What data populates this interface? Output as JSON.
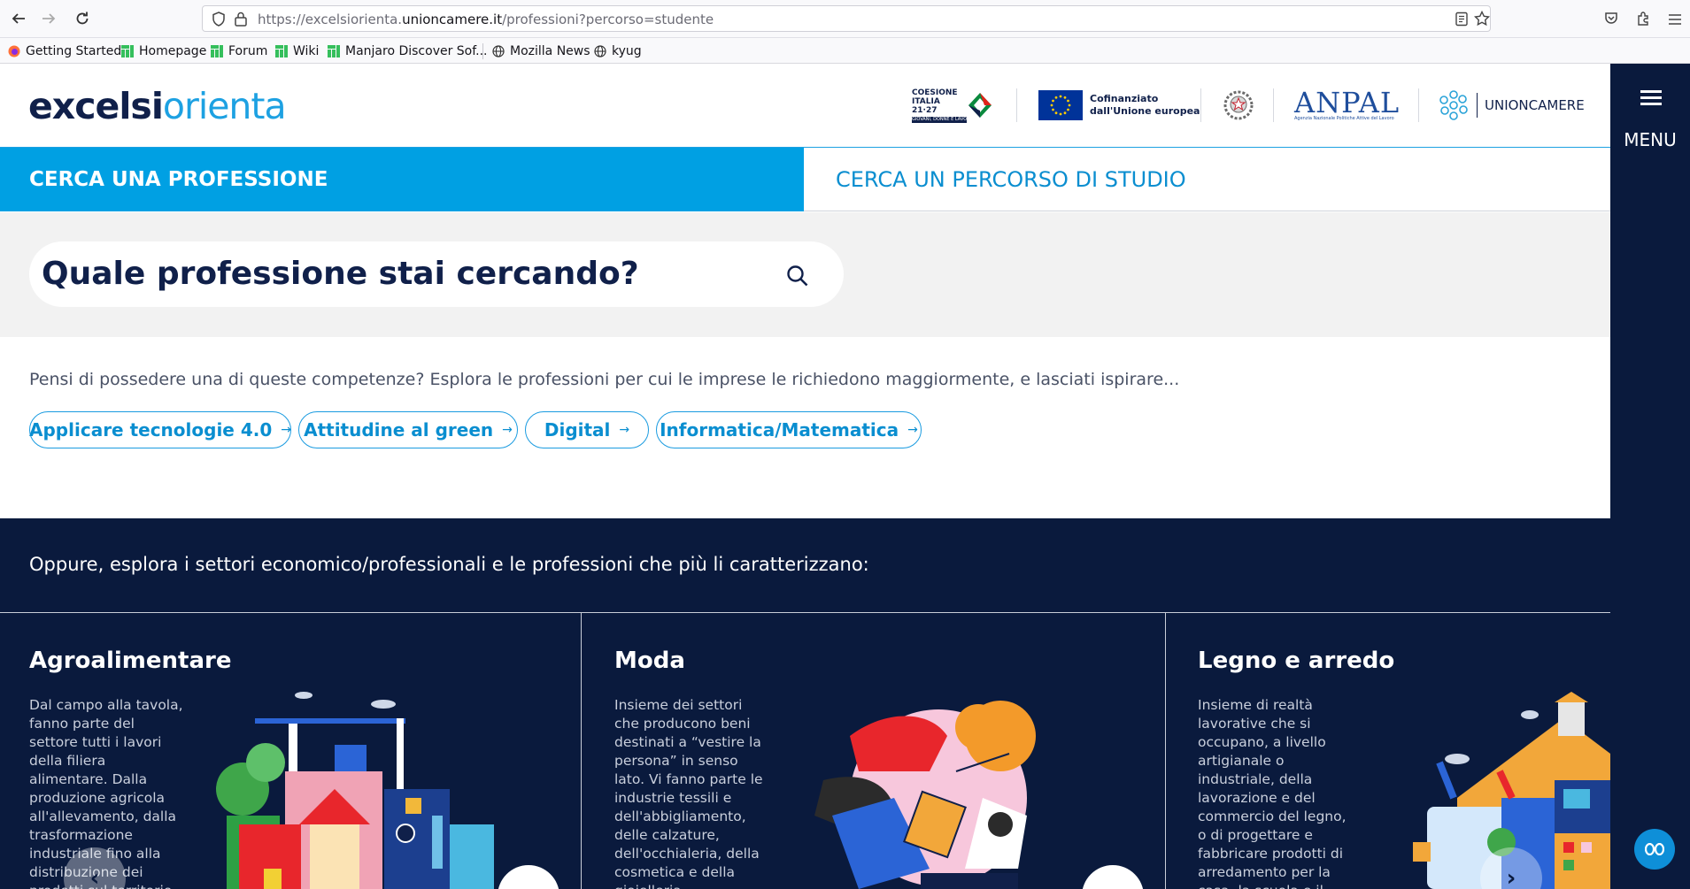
{
  "browser": {
    "url_prefix": "https://excelsiorienta.",
    "url_domain": "unioncamere.it",
    "url_path": "/professioni?percorso=studente",
    "bookmarks": [
      {
        "label": "Getting Started",
        "icon": "firefox-icon"
      },
      {
        "label": "Homepage",
        "icon": "manjaro-icon"
      },
      {
        "label": "Forum",
        "icon": "manjaro-icon"
      },
      {
        "label": "Wiki",
        "icon": "manjaro-icon"
      },
      {
        "label": "Manjaro Discover Sof...",
        "icon": "manjaro-icon"
      },
      {
        "label": "Mozilla News",
        "icon": "globe-icon"
      },
      {
        "label": "kyug",
        "icon": "globe-icon"
      }
    ]
  },
  "header": {
    "logo_part1": "excelsi",
    "logo_part2": "orienta",
    "partners": {
      "coesione_line1": "COESIONE",
      "coesione_line2": "ITALIA 21·27",
      "coesione_line3": "GIOVANI, DONNE E LAVORO",
      "eu_line1": "Cofinanziato",
      "eu_line2": "dall'Unione europea",
      "anpal": "ANPAL",
      "anpal_sub": "Agenzia Nazionale Politiche Attive del Lavoro",
      "unioncamere": "UNIONCAMERE"
    },
    "menu_label": "MENU"
  },
  "tabs": {
    "active": "CERCA UNA PROFESSIONE",
    "inactive": "CERCA UN PERCORSO DI STUDIO"
  },
  "search": {
    "placeholder": "Quale professione stai cercando?"
  },
  "skills": {
    "intro": "Pensi di possedere una di queste competenze? Esplora le professioni per cui le imprese le richiedono maggiormente, e lasciati ispirare...",
    "chips": [
      "Applicare tecnologie 4.0",
      "Attitudine al green",
      "Digital",
      "Informatica/Matematica"
    ]
  },
  "sectors": {
    "intro": "Oppure, esplora i settori economico/professionali e le professioni che più li caratterizzano:",
    "items": [
      {
        "title": "Agroalimentare",
        "description": "Dal campo alla tavola, fanno parte del settore tutti i lavori della filiera alimentare. Dalla produzione agricola all'allevamento, dalla trasformazione industriale fino alla distribuzione dei prodotti sul territorio."
      },
      {
        "title": "Moda",
        "description": "Insieme dei settori che producono beni destinati a “vestire la persona” in senso lato. Vi fanno parte le industrie tessili e dell'abbigliamento, delle calzature, dell'occhialeria, della cosmetica e della gioielleria."
      },
      {
        "title": "Legno e arredo",
        "description": "Insieme di realtà lavorative che si occupano, a livello artigianale o industriale, della lavorazione e del commercio del legno, o di progettare e fabbricare prodotti di arredamento per la casa, la scuola e il lavoro."
      }
    ]
  },
  "colors": {
    "brand_blue": "#00a0e3",
    "navy": "#0a1a3d",
    "link_blue": "#0a8ed0"
  }
}
